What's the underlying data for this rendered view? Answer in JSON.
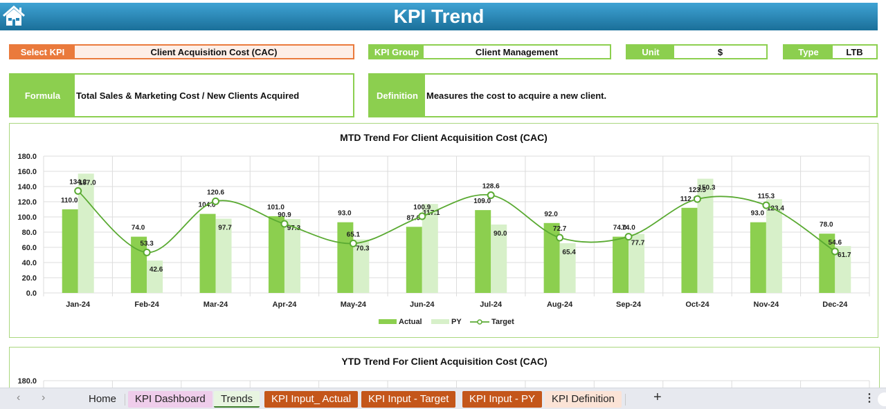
{
  "header": {
    "title": "KPI Trend",
    "home_icon": "home-icon"
  },
  "selectors": {
    "select_kpi": {
      "label": "Select KPI",
      "value": "Client Acquisition Cost (CAC)"
    },
    "kpi_group": {
      "label": "KPI Group",
      "value": "Client Management"
    },
    "unit": {
      "label": "Unit",
      "value": "$"
    },
    "type": {
      "label": "Type",
      "value": "LTB"
    },
    "formula": {
      "label": "Formula",
      "value": "Total Sales & Marketing Cost / New Clients Acquired"
    },
    "definition": {
      "label": "Definition",
      "value": "Measures the cost to acquire a new client."
    }
  },
  "colors": {
    "actual": "#8ccf4f",
    "py": "#d7f0c9",
    "target": "#5aaa32",
    "accent_orange": "#ea7a3c",
    "header_blue": "#2584b5"
  },
  "chart_data": [
    {
      "type": "bar",
      "title": "MTD Trend For Client Acquisition Cost (CAC)",
      "categories": [
        "Jan-24",
        "Feb-24",
        "Mar-24",
        "Apr-24",
        "May-24",
        "Jun-24",
        "Jul-24",
        "Aug-24",
        "Sep-24",
        "Oct-24",
        "Nov-24",
        "Dec-24"
      ],
      "series": [
        {
          "name": "Actual",
          "kind": "bar",
          "values": [
            110.0,
            74.0,
            104.0,
            101.0,
            93.0,
            87.0,
            109.0,
            92.0,
            74.0,
            112.0,
            93.0,
            78.0
          ]
        },
        {
          "name": "PY",
          "kind": "bar",
          "values": [
            157.0,
            42.6,
            97.7,
            97.3,
            70.3,
            117.1,
            90.0,
            65.4,
            77.7,
            150.3,
            123.4,
            61.7
          ]
        },
        {
          "name": "Target",
          "kind": "line",
          "values": [
            134.2,
            53.3,
            120.6,
            90.9,
            65.1,
            100.9,
            128.6,
            72.7,
            74.0,
            123.5,
            115.3,
            54.6
          ]
        }
      ],
      "yticks": [
        "0.0",
        "20.0",
        "40.0",
        "60.0",
        "80.0",
        "100.0",
        "120.0",
        "140.0",
        "160.0",
        "180.0"
      ],
      "ylim": [
        0,
        180
      ],
      "xlabel": "",
      "ylabel": "",
      "grid": true,
      "legend": "bottom-center"
    },
    {
      "type": "bar",
      "title": "YTD Trend For Client Acquisition Cost (CAC)",
      "yticks": [
        "180.0"
      ],
      "ylim": [
        0,
        180
      ],
      "grid": true
    }
  ],
  "tabs": {
    "items": [
      {
        "label": "Home",
        "style": "plain"
      },
      {
        "label": "KPI Dashboard",
        "style": "pink"
      },
      {
        "label": "Trends",
        "style": "active"
      },
      {
        "label": "KPI Input_ Actual",
        "style": "brown"
      },
      {
        "label": "KPI Input - Target",
        "style": "brown"
      },
      {
        "label": "KPI Input - PY",
        "style": "brown"
      },
      {
        "label": "KPI Definition",
        "style": "peach"
      }
    ],
    "add_label": "+",
    "more_label": "⋮",
    "prev_label": "‹",
    "next_label": "›"
  }
}
